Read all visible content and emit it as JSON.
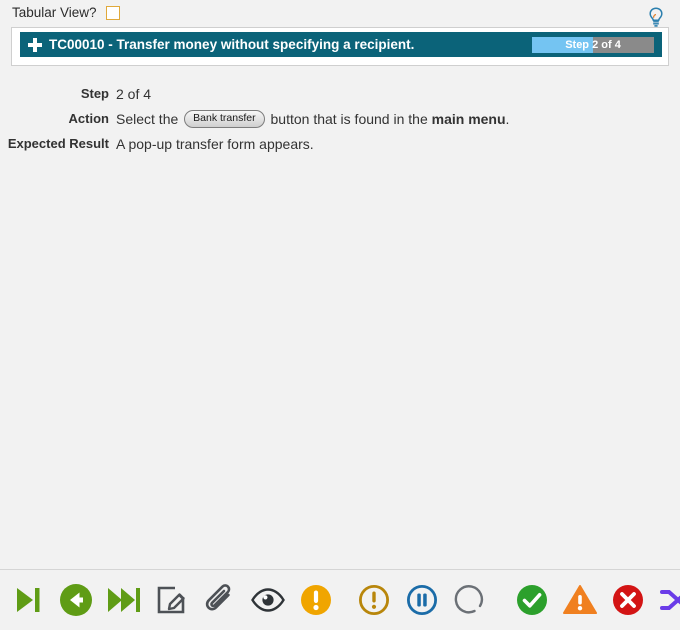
{
  "header": {
    "tabular_view_label": "Tabular View?",
    "tabular_view_checked": false,
    "hint_icon": "lightbulb-icon"
  },
  "testcase": {
    "expand_icon": "plus-icon",
    "title": "TC00010 - Transfer money without specifying a recipient.",
    "progress": {
      "text": "Step 2 of 4",
      "current": 2,
      "total": 4,
      "percent": 50,
      "fill_color": "#74c4f2",
      "track_color": "#8a8a8a"
    },
    "bar_color": "#0b6379"
  },
  "details": {
    "step_label": "Step",
    "step_value": "2 of 4",
    "action_label": "Action",
    "action_prefix": "Select the",
    "action_chip": "Bank transfer",
    "action_middle": "button that is found in the",
    "action_bold": "main menu",
    "action_suffix": ".",
    "expected_label": "Expected Result",
    "expected_value": "A pop-up transfer form appears."
  },
  "toolbar": {
    "items": [
      {
        "name": "step-forward-icon",
        "label": "Step Forward",
        "color": "#5f9c15"
      },
      {
        "name": "back-circle-icon",
        "label": "Back",
        "color": "#5f9c15"
      },
      {
        "name": "fast-forward-icon",
        "label": "Fast Forward",
        "color": "#5f9c15"
      },
      {
        "name": "edit-icon",
        "label": "Edit",
        "color": "#4d5156"
      },
      {
        "name": "attachment-icon",
        "label": "Attachment",
        "color": "#4d5156"
      },
      {
        "name": "eye-icon",
        "label": "View",
        "color": "#2f3438"
      },
      {
        "name": "exclamation-filled-icon",
        "label": "Warning",
        "color": "#f0a500"
      },
      {
        "name": "exclamation-outline-icon",
        "label": "Caution",
        "color": "#b8860b"
      },
      {
        "name": "pause-circle-icon",
        "label": "Pause",
        "color": "#1b6ca8"
      },
      {
        "name": "spinner-icon",
        "label": "In Progress",
        "color": "#6b7076"
      },
      {
        "name": "check-circle-icon",
        "label": "Pass",
        "color": "#2ca02c"
      },
      {
        "name": "warning-triangle-icon",
        "label": "Blocked",
        "color": "#f08020"
      },
      {
        "name": "error-circle-icon",
        "label": "Fail",
        "color": "#d31414"
      },
      {
        "name": "shuffle-icon",
        "label": "Random",
        "color": "#6a3ce8"
      }
    ]
  }
}
